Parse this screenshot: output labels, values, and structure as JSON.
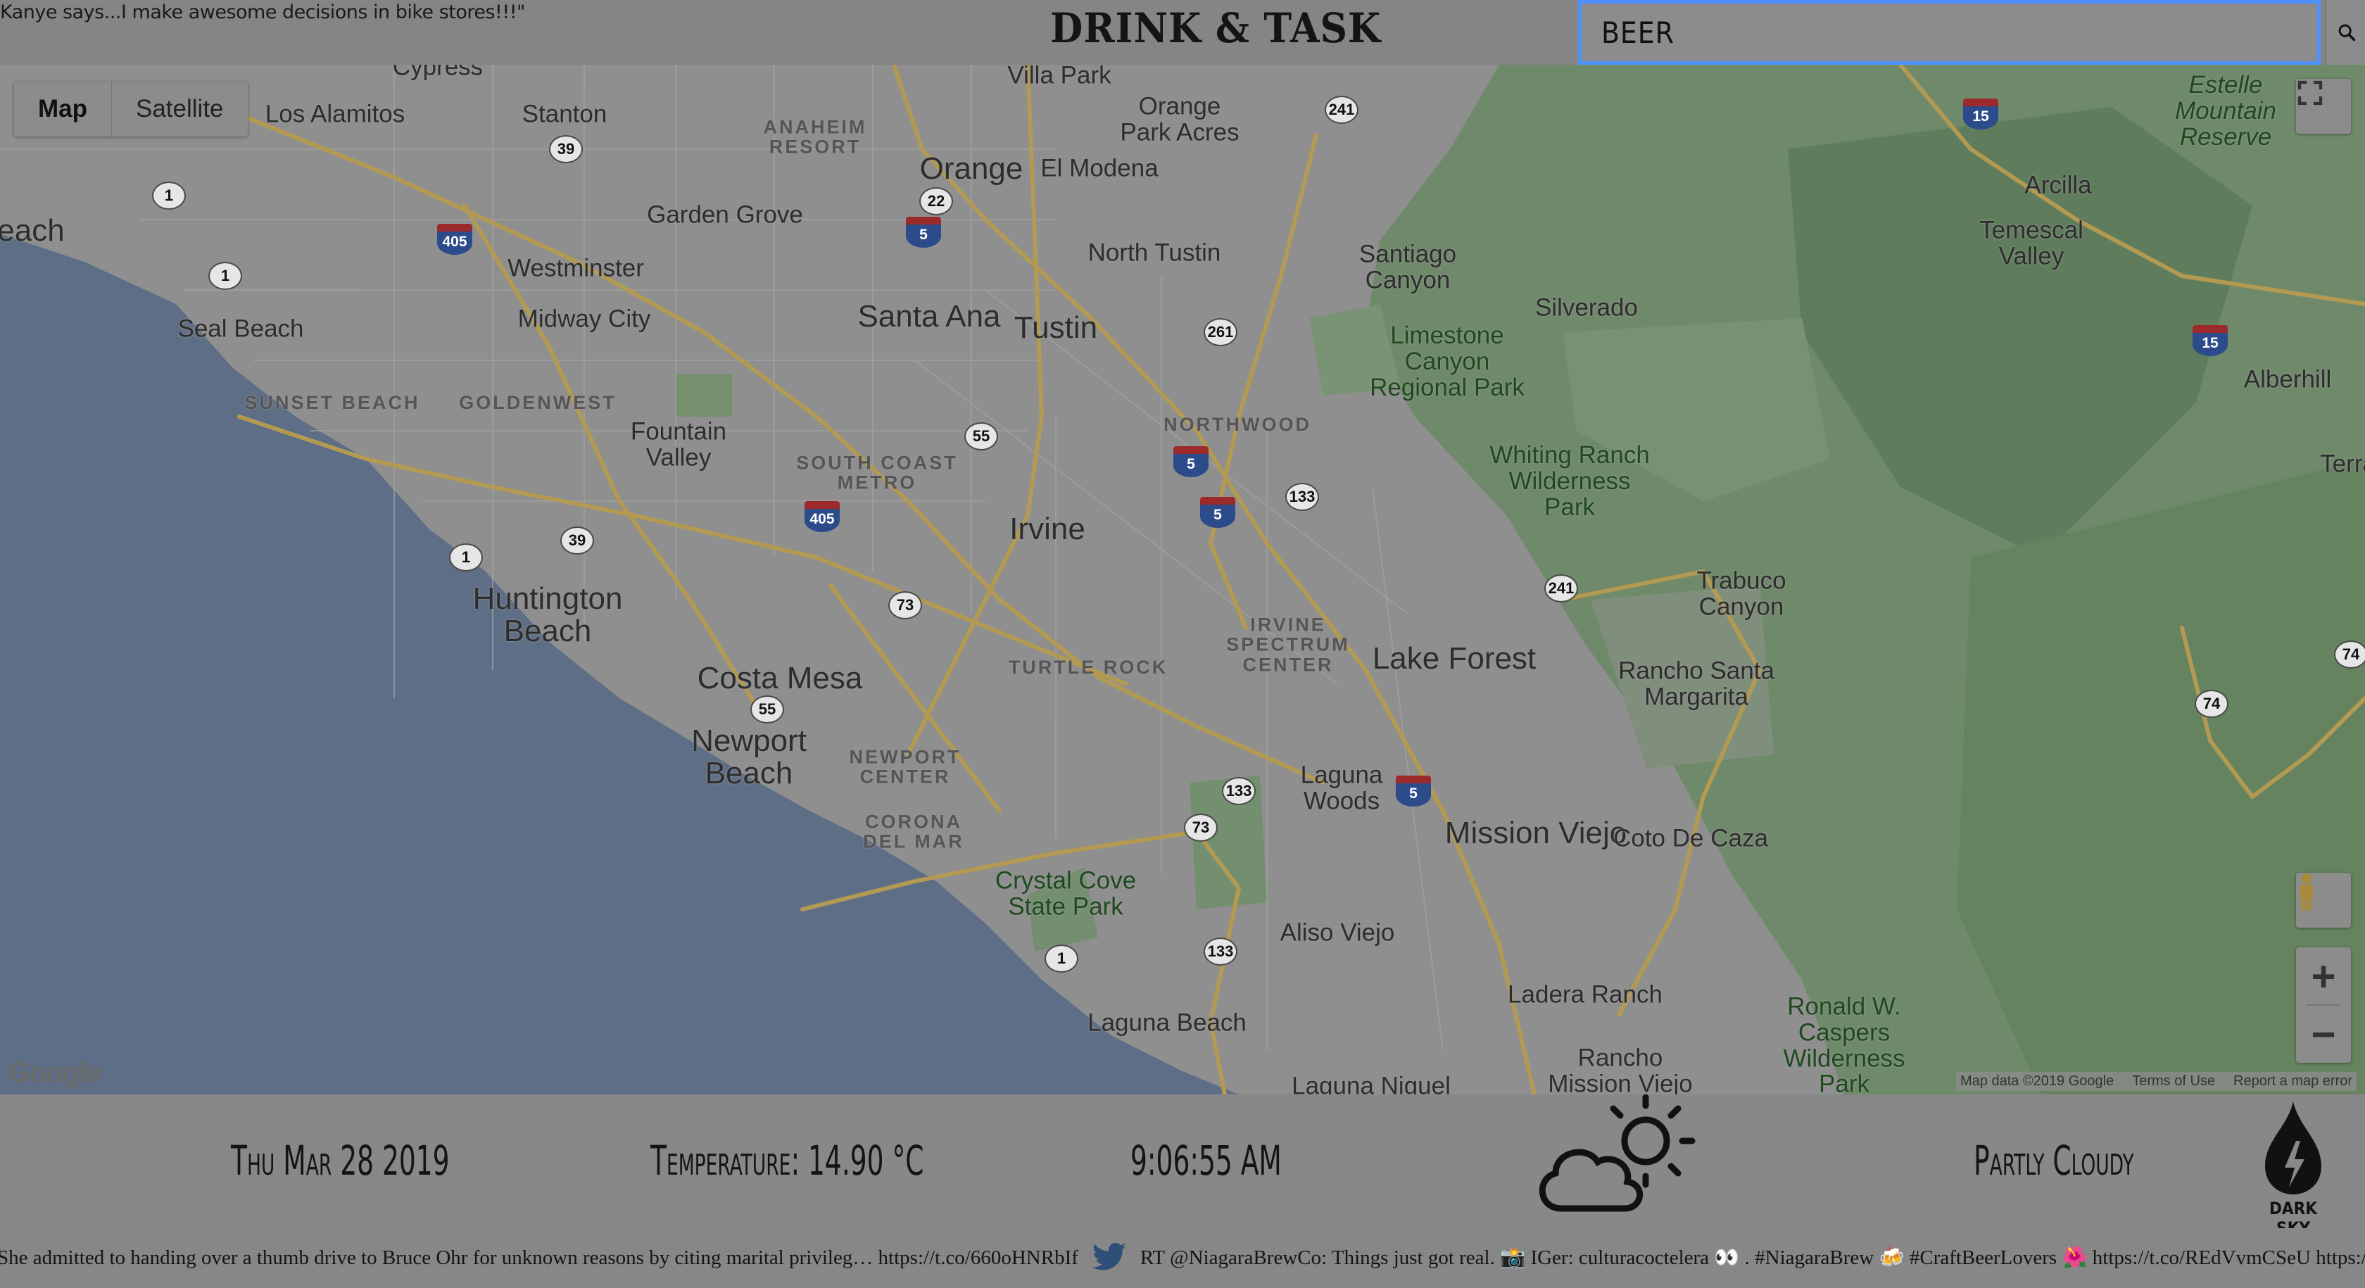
{
  "header": {
    "quote": "Kanye says...I make awesome decisions in bike stores!!!\"",
    "title": "DRINK & TASK"
  },
  "search": {
    "value": "BEER",
    "button_icon": "search-icon"
  },
  "map": {
    "map_type_buttons": [
      "Map",
      "Satellite"
    ],
    "selected_type": "Map",
    "fullscreen_icon": "fullscreen-icon",
    "pegman_icon": "pegman-icon",
    "zoom_in": "+",
    "zoom_out": "−",
    "logo": "Google",
    "attribution": "Map data ©2019 Google",
    "terms": "Terms of Use",
    "report": "Report a map error",
    "places": {
      "cypress": "Cypress",
      "villa_park": "Villa Park",
      "los_alamitos": "Los Alamitos",
      "stanton": "Stanton",
      "anaheim_resort": "ANAHEIM\nRESORT",
      "orange": "Orange",
      "orange_park_acres": "Orange\nPark Acres",
      "el_modena": "El Modena",
      "garden_grove": "Garden Grove",
      "westminster": "Westminster",
      "north_tustin": "North Tustin",
      "santiago_canyon": "Santiago\nCanyon",
      "seal_beach": "Seal Beach",
      "midway_city": "Midway City",
      "santa_ana": "Santa Ana",
      "tustin": "Tustin",
      "silverado": "Silverado",
      "limestone": "Limestone\nCanyon\nRegional Park",
      "sunset_beach": "SUNSET BEACH",
      "goldenwest": "GOLDENWEST",
      "northwood": "NORTHWOOD",
      "fountain_valley": "Fountain\nValley",
      "south_coast_metro": "SOUTH COAST\nMETRO",
      "whiting_ranch": "Whiting Ranch\nWilderness\nPark",
      "irvine": "Irvine",
      "huntington_beach": "Huntington\nBeach",
      "trabuco_canyon": "Trabuco\nCanyon",
      "irvine_spectrum": "IRVINE\nSPECTRUM\nCENTER",
      "lake_forest": "Lake Forest",
      "turtle_rock": "TURTLE ROCK",
      "rancho_santa_margarita": "Rancho Santa\nMargarita",
      "costa_mesa": "Costa Mesa",
      "newport_beach": "Newport\nBeach",
      "newport_center": "NEWPORT\nCENTER",
      "laguna_woods": "Laguna\nWoods",
      "mission_viejo": "Mission Viejo",
      "coto_de_caza": "Coto De Caza",
      "corona_del_mar": "CORONA\nDEL MAR",
      "crystal_cove": "Crystal Cove\nState Park",
      "aliso_viejo": "Aliso Viejo",
      "ladera_ranch": "Ladera Ranch",
      "laguna_beach": "Laguna Beach",
      "ronald_caspers": "Ronald W.\nCaspers\nWilderness\nPark",
      "rancho_mission_viejo": "Rancho\nMission Viejo",
      "laguna_niguel": "Laguna Niguel",
      "estelle_mountain": "Estelle\nMountain\nReserve",
      "arcilla": "Arcilla",
      "temescal_valley": "Temescal\nValley",
      "alberhill": "Alberhill",
      "terra": "Terra",
      "each": "each"
    }
  },
  "info": {
    "date": "Thu Mar 28 2019",
    "temperature": "Temperature: 14.90 °C",
    "time": "9:06:55 AM",
    "weather_icon": "partly-cloudy-day-icon",
    "summary": "Partly Cloudy",
    "dark_sky_label": "DARK SKY"
  },
  "ticker": {
    "items": [
      "She admitted to handing over a thumb drive to Bruce Ohr for unknown reasons by citing marital privileg… https://t.co/660oHNRbIf",
      "RT @NiagaraBrewCo: Things just got real. 📸 IGer: culturacoctelera 👀 . #NiagaraBrew 🍻 #CraftBeerLovers 🌺 https://t.co/REdVvmCSeU https://t…"
    ]
  },
  "colors": {
    "search_border": "#4d90fe",
    "water": "#5d6e86",
    "park": "#6b8768",
    "highway": "#b39a52",
    "overlay_gray": "#8a8a8a"
  }
}
